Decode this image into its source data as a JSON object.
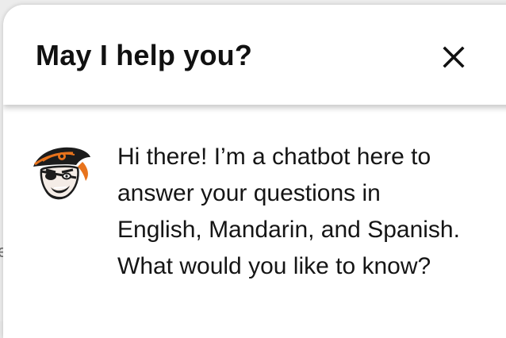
{
  "header": {
    "title": "May I help you?"
  },
  "message": {
    "lines": [
      "Hi there! I’m a chatbot here to",
      "answer your questions in",
      "English, Mandarin, and Spanish.",
      "What would you like to know?"
    ]
  },
  "icons": {
    "close": "close-icon",
    "avatar": "pirate-mascot-avatar"
  },
  "colors": {
    "accent": "#e8731c",
    "text": "#151515",
    "background": "#ffffff"
  }
}
